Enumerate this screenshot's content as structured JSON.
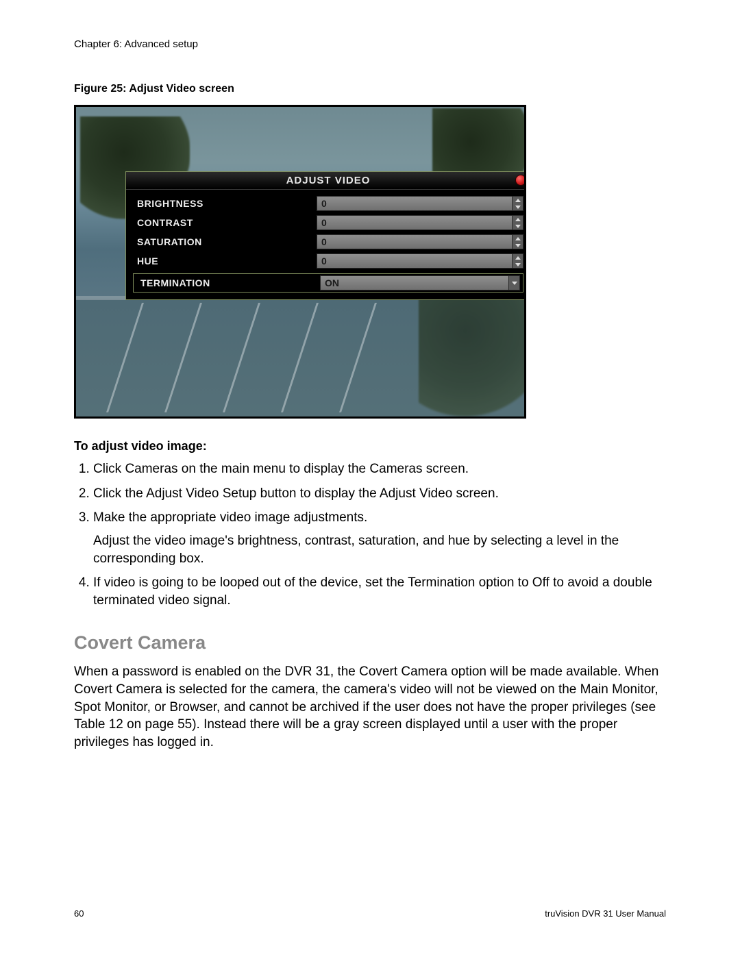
{
  "chapter": "Chapter 6: Advanced setup",
  "figure_caption": "Figure 25: Adjust Video screen",
  "dialog": {
    "title": "ADJUST VIDEO",
    "rows": {
      "brightness": {
        "label": "BRIGHTNESS",
        "value": "0"
      },
      "contrast": {
        "label": "CONTRAST",
        "value": "0"
      },
      "saturation": {
        "label": "SATURATION",
        "value": "0"
      },
      "hue": {
        "label": "HUE",
        "value": "0"
      },
      "termination": {
        "label": "TERMINATION",
        "value": "ON"
      }
    }
  },
  "instructions_heading": "To adjust video image:",
  "steps": {
    "s1": "Click Cameras on the main menu to display the Cameras screen.",
    "s2": "Click the Adjust Video Setup button to display the Adjust Video screen.",
    "s3": "Make the appropriate video image adjustments.",
    "s3b": "Adjust the video image's brightness, contrast, saturation, and hue by selecting a level in the corresponding box.",
    "s4": "If video is going to be looped out of the device, set the Termination option to Off to avoid a double terminated video signal."
  },
  "section_heading": "Covert Camera",
  "section_body": "When a password is enabled on the DVR 31, the Covert Camera option will be made available.  When Covert Camera is selected for the camera, the camera's video will not be viewed on the Main Monitor, Spot Monitor, or Browser, and cannot be archived if the user does not have the proper privileges (see Table 12 on page 55).  Instead there will be a gray screen displayed until a user with the proper privileges has logged in.",
  "footer": {
    "page": "60",
    "manual": "truVision DVR 31 User Manual"
  }
}
